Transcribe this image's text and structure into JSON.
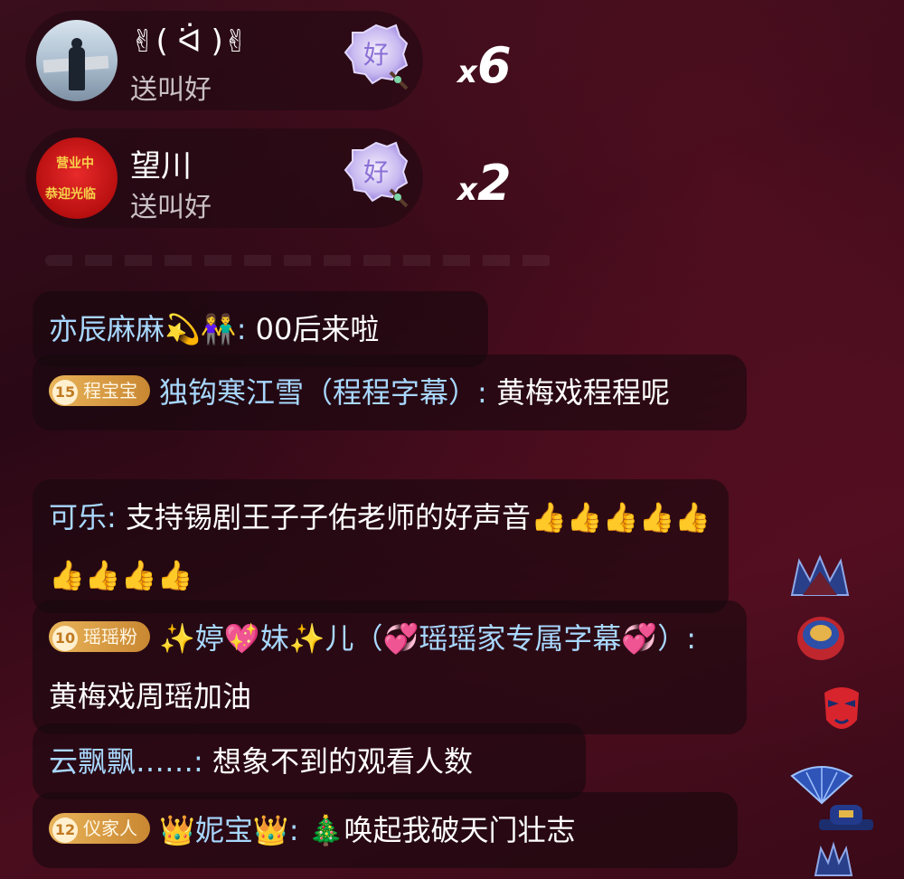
{
  "gifts": [
    {
      "user": "✌( ᐛ )✌",
      "action": "送叫好",
      "count_prefix": "x",
      "count": "6",
      "gift_glyph": "好"
    },
    {
      "user": "望川",
      "action": "送叫好",
      "count_prefix": "x",
      "count": "2",
      "gift_glyph": "好",
      "avatar_text_1": "营业中",
      "avatar_text_2": "恭迎光临"
    }
  ],
  "chat": [
    {
      "user": "亦辰麻麻💫👫",
      "sep": ": ",
      "text": "00后来啦"
    },
    {
      "badge_level": "15",
      "badge_name": "程宝宝",
      "user": "独钩寒江雪（程程字幕）",
      "sep": ": ",
      "text": "黄梅戏程程呢"
    },
    {
      "user": "可乐",
      "sep": ": ",
      "text": "支持锡剧王子子佑老师的好声音👍👍👍👍👍👍👍👍👍"
    },
    {
      "badge_level": "10",
      "badge_name": "瑶瑶粉",
      "user": "✨婷💖妹✨儿（💞瑶瑶家专属字幕💞）",
      "sep": ": ",
      "text": "黄梅戏周瑶加油"
    },
    {
      "user": "云飘飘……",
      "sep": ": ",
      "text": "想象不到的观看人数"
    },
    {
      "badge_level": "12",
      "badge_name": "仪家人",
      "user": "👑妮宝👑",
      "sep": ": ",
      "text": "🎄唤起我破天门壮志"
    }
  ],
  "side_icons": [
    "crown-mask-icon",
    "opera-drum-icon",
    "opera-mask-icon",
    "fan-icon",
    "official-hat-icon",
    "crown-mask-icon"
  ],
  "colors": {
    "username": "#a8d8ff",
    "badge": "#d99a44",
    "background": "#3a0e1c"
  }
}
